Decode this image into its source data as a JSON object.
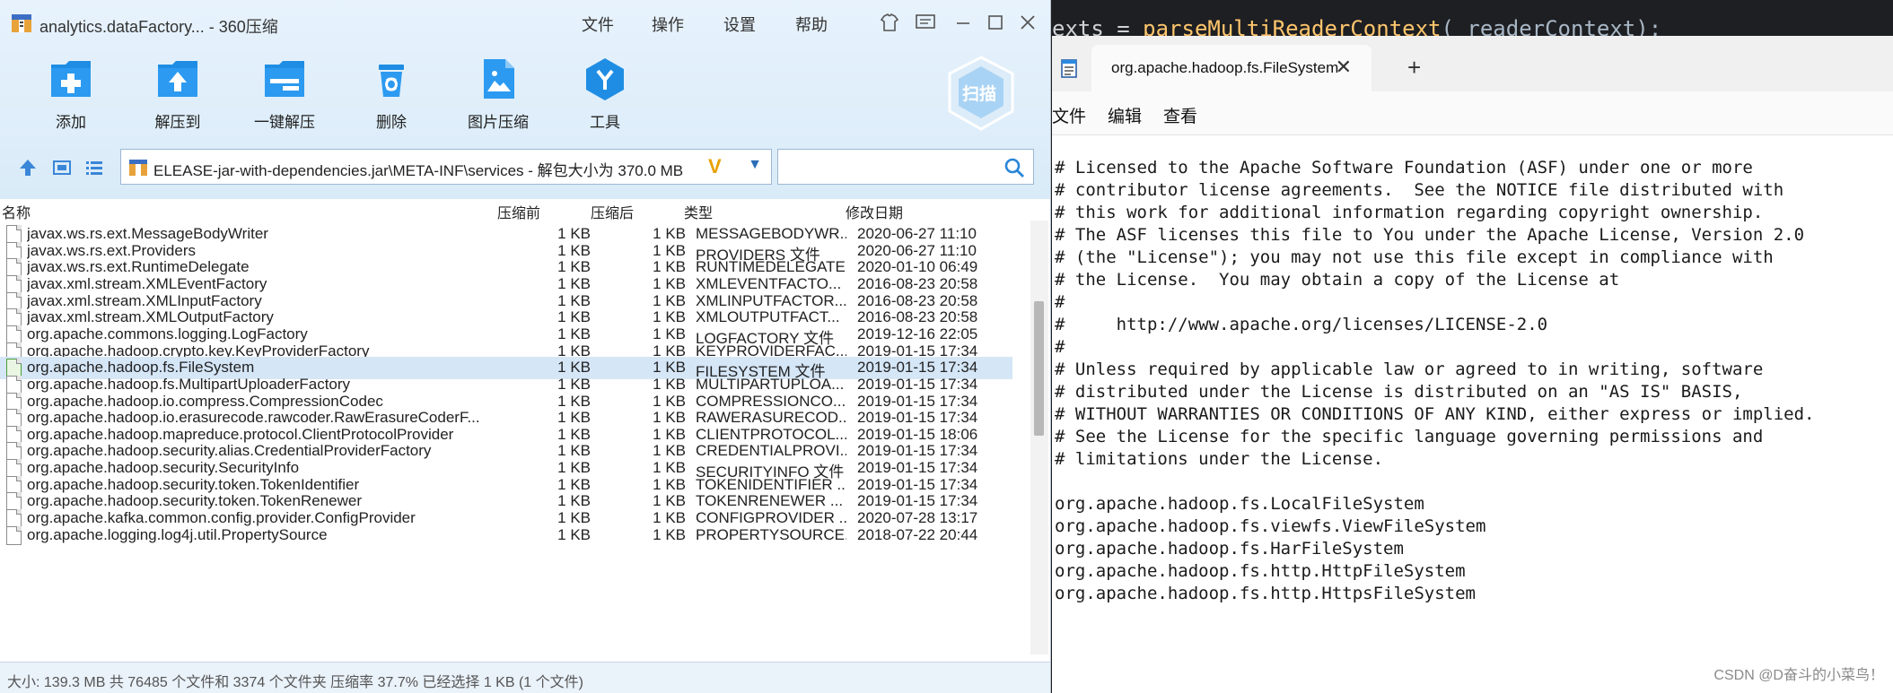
{
  "ide_background": {
    "prefix": "exts = ",
    "function": "parseMultiReaderContext",
    "args": "( readerContext);"
  },
  "zip": {
    "title": "analytics.dataFactory... - 360压缩",
    "menu": [
      "文件",
      "操作",
      "设置",
      "帮助"
    ],
    "window_controls": [
      "shirt-icon",
      "feedback-icon",
      "minimize-icon",
      "maximize-icon",
      "close-icon"
    ],
    "tools": [
      {
        "label": "添加",
        "icon": "add-icon"
      },
      {
        "label": "解压到",
        "icon": "extract-to-icon"
      },
      {
        "label": "一键解压",
        "icon": "one-click-extract-icon"
      },
      {
        "label": "删除",
        "icon": "delete-icon"
      },
      {
        "label": "图片压缩",
        "icon": "image-compress-icon"
      },
      {
        "label": "工具",
        "icon": "tools-icon"
      }
    ],
    "scan_label": "扫描",
    "address": {
      "path": "ELEASE-jar-with-dependencies.jar\\META-INF\\services - 解包大小为 370.0 MB",
      "search_value": ""
    },
    "columns": {
      "name": "名称",
      "size": "压缩前",
      "packed": "压缩后",
      "type": "类型",
      "date": "修改日期"
    },
    "rows": [
      {
        "name": "javax.ws.rs.ext.MessageBodyWriter",
        "size": "1 KB",
        "packed": "1 KB",
        "type": "MESSAGEBODYWR...",
        "date": "2020-06-27 11:10"
      },
      {
        "name": "javax.ws.rs.ext.Providers",
        "size": "1 KB",
        "packed": "1 KB",
        "type": "PROVIDERS 文件",
        "date": "2020-06-27 11:10"
      },
      {
        "name": "javax.ws.rs.ext.RuntimeDelegate",
        "size": "1 KB",
        "packed": "1 KB",
        "type": "RUNTIMEDELEGATE",
        "date": "2020-01-10 06:49"
      },
      {
        "name": "javax.xml.stream.XMLEventFactory",
        "size": "1 KB",
        "packed": "1 KB",
        "type": "XMLEVENTFACTO...",
        "date": "2016-08-23 20:58"
      },
      {
        "name": "javax.xml.stream.XMLInputFactory",
        "size": "1 KB",
        "packed": "1 KB",
        "type": "XMLINPUTFACTOR...",
        "date": "2016-08-23 20:58"
      },
      {
        "name": "javax.xml.stream.XMLOutputFactory",
        "size": "1 KB",
        "packed": "1 KB",
        "type": "XMLOUTPUTFACT...",
        "date": "2016-08-23 20:58"
      },
      {
        "name": "org.apache.commons.logging.LogFactory",
        "size": "1 KB",
        "packed": "1 KB",
        "type": "LOGFACTORY 文件",
        "date": "2019-12-16 22:05"
      },
      {
        "name": "org.apache.hadoop.crypto.key.KeyProviderFactory",
        "size": "1 KB",
        "packed": "1 KB",
        "type": "KEYPROVIDERFAC...",
        "date": "2019-01-15 17:34"
      },
      {
        "name": "org.apache.hadoop.fs.FileSystem",
        "size": "1 KB",
        "packed": "1 KB",
        "type": "FILESYSTEM 文件",
        "date": "2019-01-15 17:34",
        "selected": true
      },
      {
        "name": "org.apache.hadoop.fs.MultipartUploaderFactory",
        "size": "1 KB",
        "packed": "1 KB",
        "type": "MULTIPARTUPLOA...",
        "date": "2019-01-15 17:34"
      },
      {
        "name": "org.apache.hadoop.io.compress.CompressionCodec",
        "size": "1 KB",
        "packed": "1 KB",
        "type": "COMPRESSIONCO...",
        "date": "2019-01-15 17:34"
      },
      {
        "name": "org.apache.hadoop.io.erasurecode.rawcoder.RawErasureCoderF...",
        "size": "1 KB",
        "packed": "1 KB",
        "type": "RAWERASURECOD...",
        "date": "2019-01-15 17:34"
      },
      {
        "name": "org.apache.hadoop.mapreduce.protocol.ClientProtocolProvider",
        "size": "1 KB",
        "packed": "1 KB",
        "type": "CLIENTPROTOCOL...",
        "date": "2019-01-15 18:06"
      },
      {
        "name": "org.apache.hadoop.security.alias.CredentialProviderFactory",
        "size": "1 KB",
        "packed": "1 KB",
        "type": "CREDENTIALPROVI...",
        "date": "2019-01-15 17:34"
      },
      {
        "name": "org.apache.hadoop.security.SecurityInfo",
        "size": "1 KB",
        "packed": "1 KB",
        "type": "SECURITYINFO 文件",
        "date": "2019-01-15 17:34"
      },
      {
        "name": "org.apache.hadoop.security.token.TokenIdentifier",
        "size": "1 KB",
        "packed": "1 KB",
        "type": "TOKENIDENTIFIER ...",
        "date": "2019-01-15 17:34"
      },
      {
        "name": "org.apache.hadoop.security.token.TokenRenewer",
        "size": "1 KB",
        "packed": "1 KB",
        "type": "TOKENRENEWER ...",
        "date": "2019-01-15 17:34"
      },
      {
        "name": "org.apache.kafka.common.config.provider.ConfigProvider",
        "size": "1 KB",
        "packed": "1 KB",
        "type": "CONFIGPROVIDER ...",
        "date": "2020-07-28 13:17"
      },
      {
        "name": "org.apache.logging.log4j.util.PropertySource",
        "size": "1 KB",
        "packed": "1 KB",
        "type": "PROPERTYSOURCE...",
        "date": "2018-07-22 20:44"
      }
    ],
    "status": "大小: 139.3 MB 共 76485 个文件和 3374 个文件夹 压缩率 37.7% 已经选择 1 KB (1 个文件)"
  },
  "notepad": {
    "tab_title": "org.apache.hadoop.fs.FileSystem",
    "menu": [
      "文件",
      "编辑",
      "查看"
    ],
    "lines": [
      "# Licensed to the Apache Software Foundation (ASF) under one or more",
      "# contributor license agreements.  See the NOTICE file distributed with",
      "# this work for additional information regarding copyright ownership.",
      "# The ASF licenses this file to You under the Apache License, Version 2.0",
      "# (the \"License\"); you may not use this file except in compliance with",
      "# the License.  You may obtain a copy of the License at",
      "#",
      "#     http://www.apache.org/licenses/LICENSE-2.0",
      "#",
      "# Unless required by applicable law or agreed to in writing, software",
      "# distributed under the License is distributed on an \"AS IS\" BASIS,",
      "# WITHOUT WARRANTIES OR CONDITIONS OF ANY KIND, either express or implied.",
      "# See the License for the specific language governing permissions and",
      "# limitations under the License.",
      "",
      "org.apache.hadoop.fs.LocalFileSystem",
      "org.apache.hadoop.fs.viewfs.ViewFileSystem",
      "org.apache.hadoop.fs.HarFileSystem",
      "org.apache.hadoop.fs.http.HttpFileSystem",
      "org.apache.hadoop.fs.http.HttpsFileSystem"
    ]
  },
  "watermark": "CSDN @D奋斗的小菜鸟！",
  "colors": {
    "accent_blue": "#2a8ae0",
    "selection": "#d5e6f7",
    "toolbar_bg": "#e7f2fc",
    "ide_bg": "#1e1f22"
  }
}
